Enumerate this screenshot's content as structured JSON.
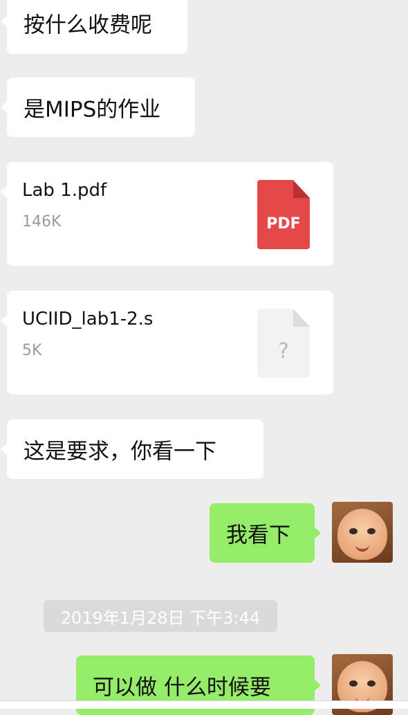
{
  "messages": [
    {
      "text": "按什么收费呢"
    },
    {
      "text": "是MIPS的作业"
    },
    {
      "file_name": "Lab 1.pdf",
      "file_size": "146K",
      "icon": "pdf-file-icon",
      "icon_label": "PDF",
      "icon_color": "#e6484a"
    },
    {
      "file_name": "UCIID_lab1-2.s",
      "file_size": "5K",
      "icon": "unknown-file-icon",
      "icon_label": "?"
    },
    {
      "text": "这是要求，你看一下"
    },
    {
      "text": "我看下"
    },
    {
      "text": "可以做 什么时候要"
    }
  ],
  "timestamp": "2019年1月28日 下午3:44",
  "colors": {
    "background": "#ededed",
    "incoming_bubble": "#ffffff",
    "outgoing_bubble": "#95ec69",
    "timestamp_bg": "#dadada"
  },
  "avatar_icon": "baby-face-avatar"
}
